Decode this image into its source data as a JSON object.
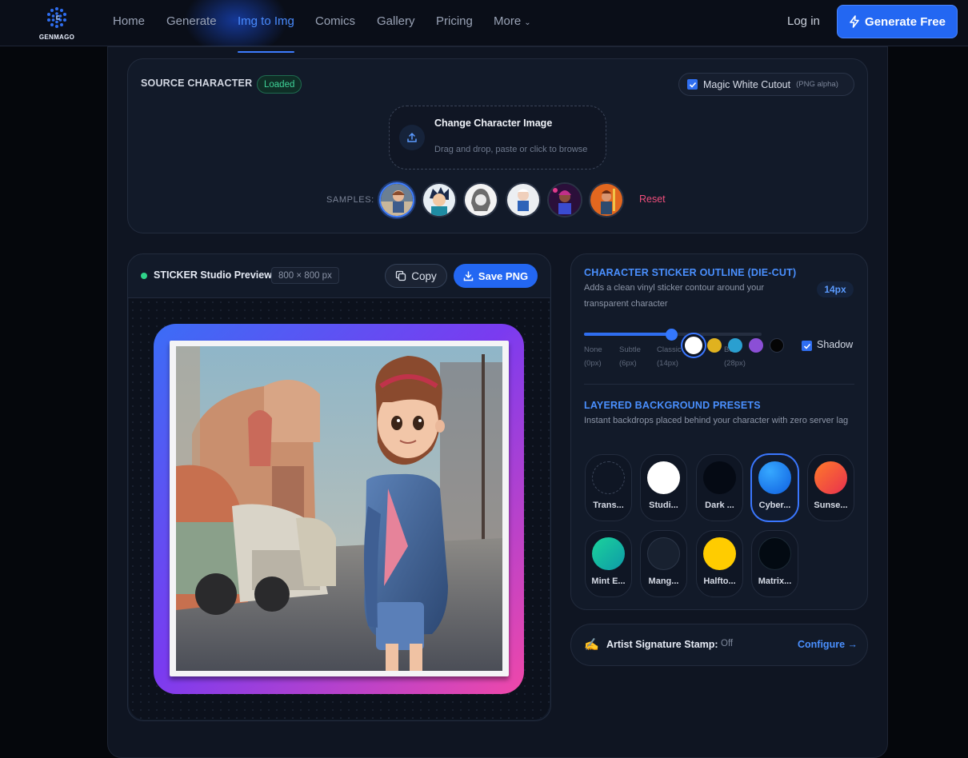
{
  "brand": {
    "name": "GENMAGO"
  },
  "nav": {
    "items": [
      "Home",
      "Generate",
      "Img to Img",
      "Comics",
      "Gallery",
      "Pricing",
      "More"
    ],
    "active": "Img to Img",
    "login": "Log in",
    "cta": "Generate Free"
  },
  "source": {
    "title": "SOURCE CHARACTER",
    "status": "Loaded",
    "magic_cutout": {
      "label": "Magic White Cutout",
      "sub": "(PNG alpha)",
      "checked": true
    },
    "dropzone": {
      "title": "Change Character Image",
      "subtitle": "Drag and drop, paste or click to browse"
    },
    "samples_label": "SAMPLES:",
    "reset": "Reset"
  },
  "preview": {
    "title": "STICKER Studio Preview",
    "dimensions": "800 × 800 px",
    "copy": "Copy",
    "save": "Save PNG"
  },
  "outline": {
    "title": "CHARACTER STICKER OUTLINE (DIE-CUT)",
    "description": "Adds a clean vinyl sticker contour around your transparent character",
    "value": "14px",
    "ticks": [
      {
        "name": "None",
        "px": "(0px)"
      },
      {
        "name": "Subtle",
        "px": "(6px)"
      },
      {
        "name": "Classic",
        "px": "(14px)"
      },
      {
        "name": "Bold",
        "px": "(28px)"
      }
    ],
    "colors": [
      "#ffffff",
      "#e0b21f",
      "#2a9fd0",
      "#8b4fd6",
      "#050505"
    ],
    "selected_color": "#ffffff",
    "shadow": {
      "label": "Shadow",
      "checked": true
    }
  },
  "backgrounds": {
    "title": "LAYERED BACKGROUND PRESETS",
    "description": "Instant backdrops placed behind your character with zero server lag",
    "presets": [
      {
        "label": "Trans...",
        "color": "#0f1624"
      },
      {
        "label": "Studi...",
        "color": "#ffffff"
      },
      {
        "label": "Dark ...",
        "color": "#050a14"
      },
      {
        "label": "Cyber...",
        "color": "#1a7af0"
      },
      {
        "label": "Sunse...",
        "color": "#f0503c"
      },
      {
        "label": "Mint E...",
        "color": "#12b89a"
      },
      {
        "label": "Mang...",
        "color": "#182130"
      },
      {
        "label": "Halfto...",
        "color": "#ffcc00"
      },
      {
        "label": "Matrix...",
        "color": "#030a12"
      }
    ],
    "selected": "Cyber..."
  },
  "signature": {
    "icon": "writing-hand-icon",
    "label": "Artist Signature Stamp:",
    "value": "Off",
    "action": "Configure"
  }
}
